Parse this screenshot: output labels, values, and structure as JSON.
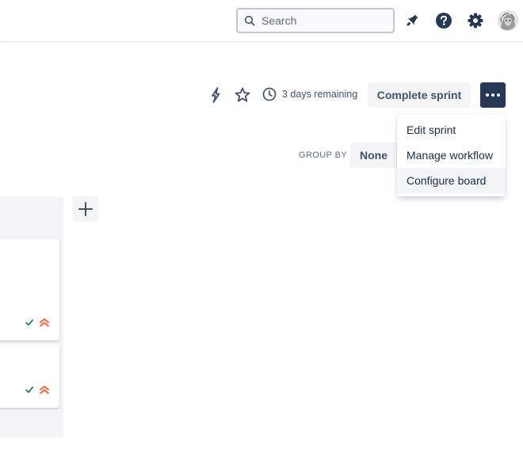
{
  "topbar": {
    "search_placeholder": "Search",
    "icons": [
      "search-icon",
      "notification-icon",
      "help-icon",
      "settings-icon",
      "avatar"
    ]
  },
  "sprint": {
    "days_remaining": "3 days remaining",
    "complete_label": "Complete sprint",
    "icons": [
      "lightning-icon",
      "star-icon",
      "clock-icon",
      "more-icon"
    ]
  },
  "group_by": {
    "label": "GROUP BY",
    "value": "None"
  },
  "menu": {
    "items": [
      {
        "label": "Edit sprint"
      },
      {
        "label": "Manage workflow"
      },
      {
        "label": "Configure board"
      }
    ],
    "highlighted_index": 2
  },
  "board": {
    "cards": [
      {
        "icons": [
          "done-check-icon",
          "highest-priority-icon"
        ]
      },
      {
        "icons": [
          "done-check-icon",
          "highest-priority-icon"
        ]
      }
    ]
  },
  "colors": {
    "primary_dark": "#253858",
    "text": "#172b4d",
    "subtle_text": "#42526e",
    "neutral_bg": "#f4f5f7",
    "check_green": "#00875a",
    "priority_orange": "#ff5630"
  }
}
